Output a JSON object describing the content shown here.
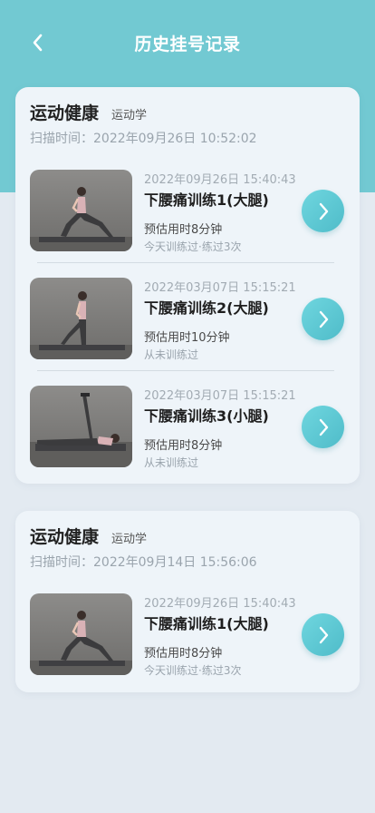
{
  "nav": {
    "title": "历史挂号记录"
  },
  "records": [
    {
      "title": "运动健康",
      "tag": "运动学",
      "scan_time": "扫描时间：2022年09月26日 10:52:02",
      "items": [
        {
          "date": "2022年09月26日 15:40:43",
          "name": "下腰痛训练1(大腿)",
          "duration": "预估用时8分钟",
          "status": "今天训练过·练过3次",
          "pose": "lunge"
        },
        {
          "date": "2022年03月07日 15:15:21",
          "name": "下腰痛训练2(大腿)",
          "duration": "预估用时10分钟",
          "status": "从未训练过",
          "pose": "stand-stretch"
        },
        {
          "date": "2022年03月07日 15:15:21",
          "name": "下腰痛训练3(小腿)",
          "duration": "预估用时8分钟",
          "status": "从未训练过",
          "pose": "lying"
        }
      ]
    },
    {
      "title": "运动健康",
      "tag": "运动学",
      "scan_time": "扫描时间：2022年09月14日 15:56:06",
      "items": [
        {
          "date": "2022年09月26日 15:40:43",
          "name": "下腰痛训练1(大腿)",
          "duration": "预估用时8分钟",
          "status": "今天训练过·练过3次",
          "pose": "lunge"
        }
      ]
    }
  ],
  "colors": {
    "header": "#72c9d2",
    "button": "#5cc8d3",
    "background": "#e3eaf1"
  }
}
